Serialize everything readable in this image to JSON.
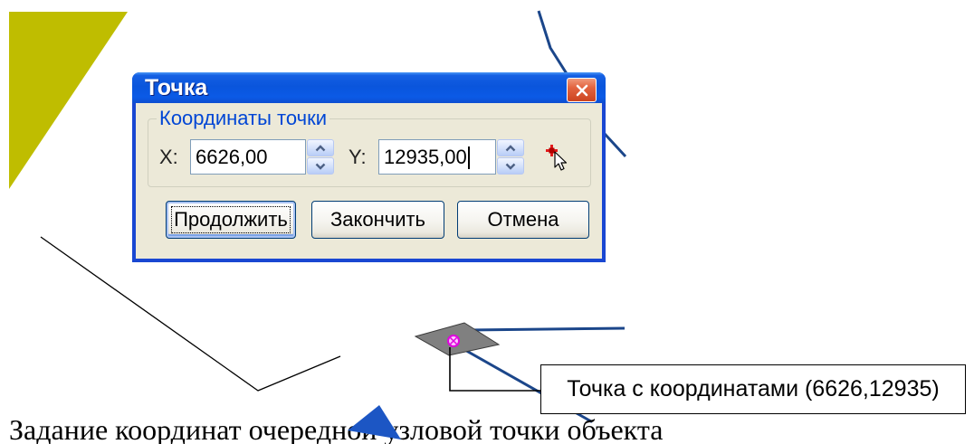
{
  "dialog": {
    "title": "Точка",
    "group_label": "Координаты точки",
    "x_label": "X:",
    "x_value": "6626,00",
    "y_label": "Y:",
    "y_value": "12935,00",
    "buttons": {
      "continue": "Продолжить",
      "finish": "Закончить",
      "cancel": "Отмена"
    },
    "icons": {
      "close": "close-icon",
      "spin_up": "spin-up-icon",
      "spin_down": "spin-down-icon",
      "pick_point": "pick-point-icon"
    }
  },
  "callout": {
    "text": "Точка с координатами (6626,12935)"
  },
  "caption": {
    "text": "Задание координат очередной узловой точки объекта"
  },
  "colors": {
    "olive_area": "#bfbd00",
    "blue_area": "#1c56c4",
    "blue_line": "#1b468a",
    "black_line": "#000000",
    "grey_node": "#808080",
    "marker": "#e000e0"
  }
}
